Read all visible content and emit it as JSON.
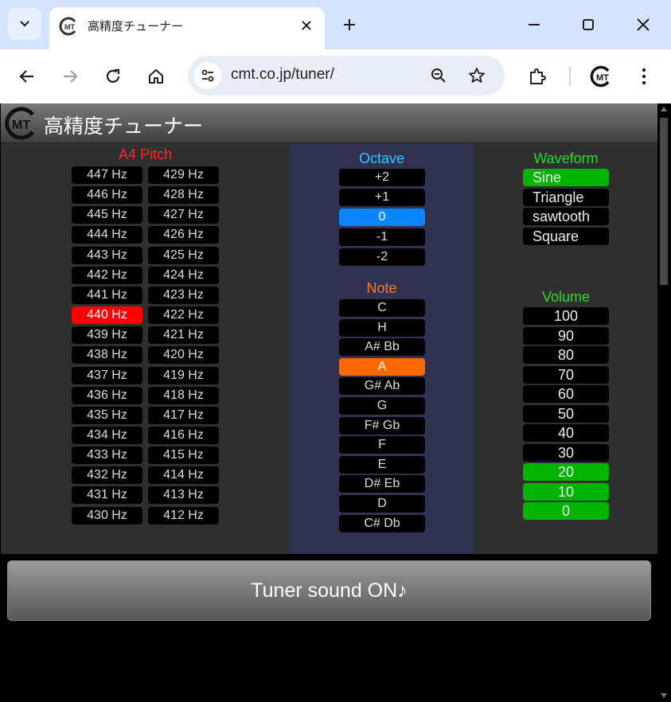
{
  "browser": {
    "tab_title": "高精度チューナー",
    "url": "cmt.co.jp/tuner/"
  },
  "app": {
    "title": "高精度チューナー",
    "logo_text": "MT"
  },
  "pitch": {
    "label": "A4 Pitch",
    "label_color": "#ff2222",
    "selected": "440 Hz",
    "col1": [
      "447 Hz",
      "446 Hz",
      "445 Hz",
      "444 Hz",
      "443 Hz",
      "442 Hz",
      "441 Hz",
      "440 Hz",
      "439 Hz",
      "438 Hz",
      "437 Hz",
      "436 Hz",
      "435 Hz",
      "434 Hz",
      "433 Hz",
      "432 Hz",
      "431 Hz",
      "430 Hz"
    ],
    "col2": [
      "429 Hz",
      "428 Hz",
      "427 Hz",
      "426 Hz",
      "425 Hz",
      "424 Hz",
      "423 Hz",
      "422 Hz",
      "421 Hz",
      "420 Hz",
      "419 Hz",
      "418 Hz",
      "417 Hz",
      "416 Hz",
      "415 Hz",
      "414 Hz",
      "413 Hz",
      "412 Hz"
    ]
  },
  "octave": {
    "label": "Octave",
    "label_color": "#22ccff",
    "selected": "0",
    "items": [
      "+2",
      "+1",
      "0",
      "-1",
      "-2"
    ]
  },
  "note": {
    "label": "Note",
    "label_color": "#ff7a1a",
    "selected": "A",
    "items": [
      "C",
      "H",
      "A# Bb",
      "A",
      "G# Ab",
      "G",
      "F# Gb",
      "F",
      "E",
      "D# Eb",
      "D",
      "C# Db"
    ]
  },
  "waveform": {
    "label": "Waveform",
    "label_color": "#22dd22",
    "selected": "Sine",
    "items": [
      "Sine",
      "Triangle",
      "sawtooth",
      "Square"
    ]
  },
  "volume": {
    "label": "Volume",
    "label_color": "#22dd22",
    "active_up_to": "20",
    "items": [
      "100",
      "90",
      "80",
      "70",
      "60",
      "50",
      "40",
      "30",
      "20",
      "10",
      "0"
    ]
  },
  "sound_button": {
    "label": "Tuner sound ON♪"
  }
}
